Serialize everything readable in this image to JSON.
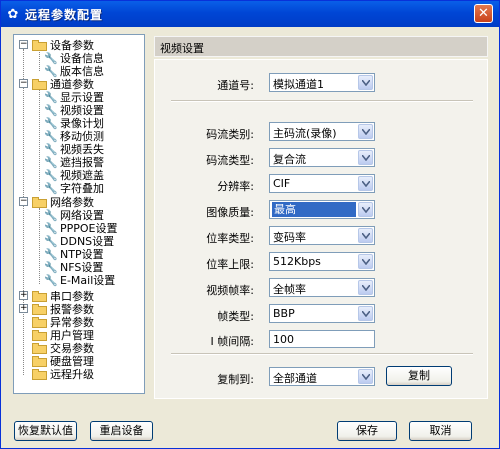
{
  "window": {
    "title": "远程参数配置",
    "close": "✕"
  },
  "tree": {
    "items": [
      {
        "label": "设备参数"
      },
      {
        "label": "设备信息"
      },
      {
        "label": "版本信息"
      },
      {
        "label": "通道参数"
      },
      {
        "label": "显示设置"
      },
      {
        "label": "视频设置"
      },
      {
        "label": "录像计划"
      },
      {
        "label": "移动侦测"
      },
      {
        "label": "视频丢失"
      },
      {
        "label": "遮挡报警"
      },
      {
        "label": "视频遮盖"
      },
      {
        "label": "字符叠加"
      },
      {
        "label": "网络参数"
      },
      {
        "label": "网络设置"
      },
      {
        "label": "PPPOE设置"
      },
      {
        "label": "DDNS设置"
      },
      {
        "label": "NTP设置"
      },
      {
        "label": "NFS设置"
      },
      {
        "label": "E-Mail设置"
      },
      {
        "label": "串口参数"
      },
      {
        "label": "报警参数"
      },
      {
        "label": "异常参数"
      },
      {
        "label": "用户管理"
      },
      {
        "label": "交易参数"
      },
      {
        "label": "硬盘管理"
      },
      {
        "label": "远程升级"
      }
    ]
  },
  "panel": {
    "title": "视频设置",
    "channel": {
      "label": "通道号:",
      "value": "模拟通道1"
    },
    "fields": [
      {
        "label": "码流类别:",
        "value": "主码流(录像)"
      },
      {
        "label": "码流类型:",
        "value": "复合流"
      },
      {
        "label": "分辨率:",
        "value": "CIF"
      },
      {
        "label": "图像质量:",
        "value": "最高"
      },
      {
        "label": "位率类型:",
        "value": "变码率"
      },
      {
        "label": "位率上限:",
        "value": "512Kbps"
      },
      {
        "label": "视频帧率:",
        "value": "全帧率"
      },
      {
        "label": "帧类型:",
        "value": "BBP"
      },
      {
        "label": "I 帧间隔:",
        "value": "100"
      }
    ],
    "copy": {
      "label": "复制到:",
      "value": "全部通道",
      "button": "复制"
    }
  },
  "footer": {
    "restore_default": "恢复默认值",
    "restart": "重启设备",
    "save": "保存",
    "cancel": "取消"
  }
}
